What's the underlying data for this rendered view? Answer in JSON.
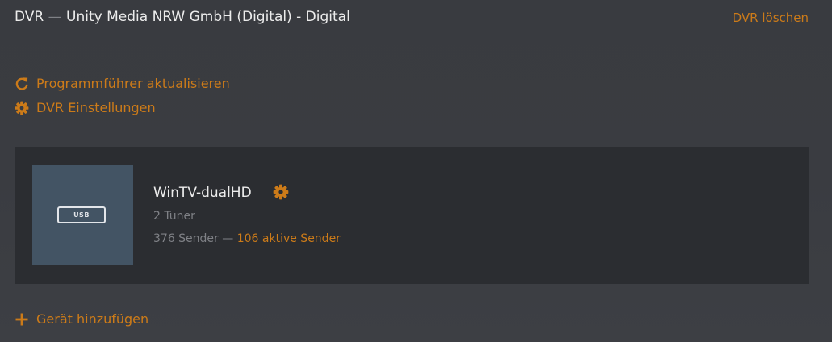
{
  "header": {
    "title_prefix": "DVR",
    "title_separator": "—",
    "title_name": "Unity Media NRW GmbH (Digital) - Digital",
    "delete_label": "DVR löschen"
  },
  "actions": {
    "refresh_guide_label": "Programmführer aktualisieren",
    "refresh_guide_icon": "refresh-icon",
    "dvr_settings_label": "DVR Einstellungen",
    "dvr_settings_icon": "gear-icon",
    "add_device_label": "Gerät hinzufügen",
    "add_device_icon": "plus-icon"
  },
  "device": {
    "image_label": "USB",
    "name": "WinTV-dualHD",
    "settings_icon": "gear-icon",
    "tuners": "2 Tuner",
    "channels": "376 Sender",
    "channels_separator": "—",
    "active_channels": "106 aktive Sender"
  },
  "colors": {
    "accent": "#cc7b19",
    "background": "#3a3c41",
    "card": "#2b2d31",
    "device_image": "#435464",
    "muted_text": "#7f8186",
    "primary_text": "#ececec"
  }
}
